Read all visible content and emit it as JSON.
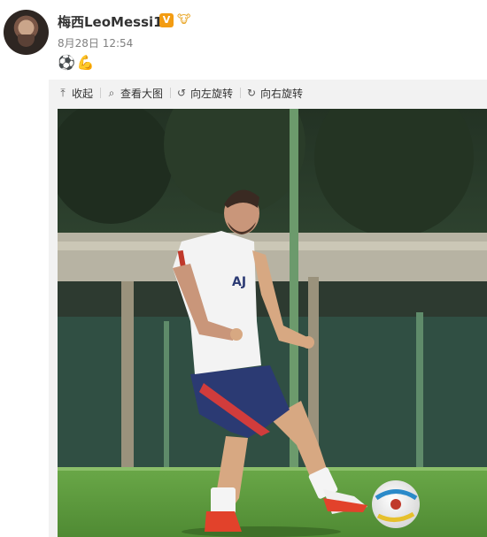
{
  "post": {
    "username": "梅西LeoMessi10",
    "verified_badge": "V",
    "date": "8月28日 12:54",
    "content_emojis": [
      "⚽",
      "💪"
    ]
  },
  "toolbar": {
    "items": [
      {
        "icon": "collapse-icon",
        "glyph": "⤒",
        "label": "收起"
      },
      {
        "icon": "search-icon",
        "glyph": "⌕",
        "label": "查看大图"
      },
      {
        "icon": "rotate-left-icon",
        "glyph": "↺",
        "label": "向左旋转"
      },
      {
        "icon": "rotate-right-icon",
        "glyph": "↻",
        "label": "向右旋转"
      }
    ]
  },
  "colors": {
    "accent_badge": "#f39c12",
    "grass": "#5d9a3c",
    "jersey_white": "#f3f3f3",
    "shorts_navy": "#2b3a73"
  }
}
